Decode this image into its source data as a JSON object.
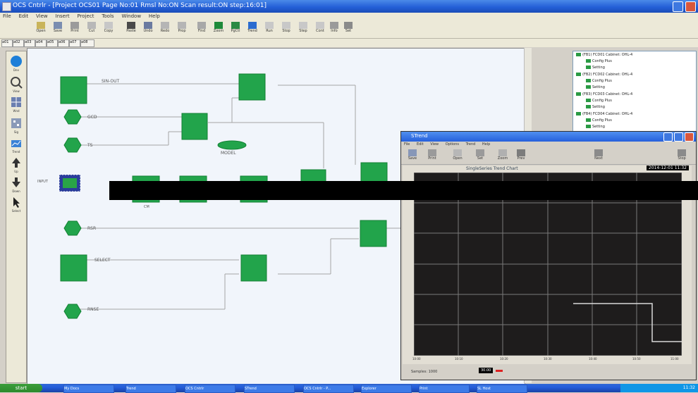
{
  "window": {
    "title": "OCS Cntrlr - [Project OCS01 Page No:01 Rmsl No:ON Scan result:ON step:16:01]"
  },
  "menu": [
    "File",
    "Edit",
    "View",
    "Insert",
    "Project",
    "Tools",
    "Window",
    "Help"
  ],
  "toolbar": {
    "buttons": [
      "Open",
      "Save",
      "Print",
      "Cut",
      "Copy",
      "Paste",
      "Undo",
      "Redo",
      "Prop",
      "Find",
      "Zoom",
      "PgCtl",
      "Trend",
      "Run",
      "Stop",
      "Step",
      "Cont",
      "Info",
      "Set",
      "Off"
    ]
  },
  "tabs": [
    "a01",
    "a02",
    "a03",
    "a04",
    "a05",
    "a06",
    "a07",
    "a08"
  ],
  "palette": [
    "Dev",
    "View",
    "Wnd",
    "Sig",
    "Trend",
    "Up",
    "Down",
    "Select"
  ],
  "diagram": {
    "labels": {
      "sin1": "SIN-OUT",
      "gcd": "GCD",
      "ts": "TS",
      "model": "MODEL",
      "rsr": "RSR",
      "select": "SELECT",
      "rnse": "RNSE",
      "in1": "INPUT",
      "cm": "CM"
    }
  },
  "tree": {
    "items": [
      "(FB1) FCD01 Cabinet: OHL-4",
      "Config Plus",
      "Setting",
      "(FB2) FCD02 Cabinet: OHL-4",
      "Config Plus",
      "Setting",
      "(FB3) FCD03 Cabinet: OHL-4",
      "Config Plus",
      "Setting",
      "(FB4) FCD04 Cabinet: OHL-4",
      "Config Plus",
      "Setting"
    ]
  },
  "trend": {
    "title": "STrend",
    "menu": [
      "File",
      "Edit",
      "View",
      "Options",
      "Trend",
      "Help"
    ],
    "tools": [
      "Save",
      "Print",
      "Open",
      "Set",
      "Zoom",
      "Prev",
      "Next",
      "Stop"
    ],
    "plot_title": "SingleSeries Trend Chart",
    "date_box": "2014-12-01 11:32",
    "status_text": "Samples: 1000",
    "status_value": "30.00",
    "axis_ticks": [
      "10:00",
      "10:10",
      "10:20",
      "10:30",
      "10:40",
      "10:50",
      "11:00"
    ],
    "colors": {
      "background": "#1e1c1c",
      "grid": "#7a7a7a",
      "series": "#d8d8d8"
    }
  },
  "taskbar": {
    "start": "start",
    "tasks": [
      "My Docs",
      "Trend",
      "OCS Cntrlr",
      "STrend",
      "OCS Cntrlr - P...",
      "Explorer",
      "Print",
      "SL Host"
    ],
    "clock": "11:32"
  }
}
